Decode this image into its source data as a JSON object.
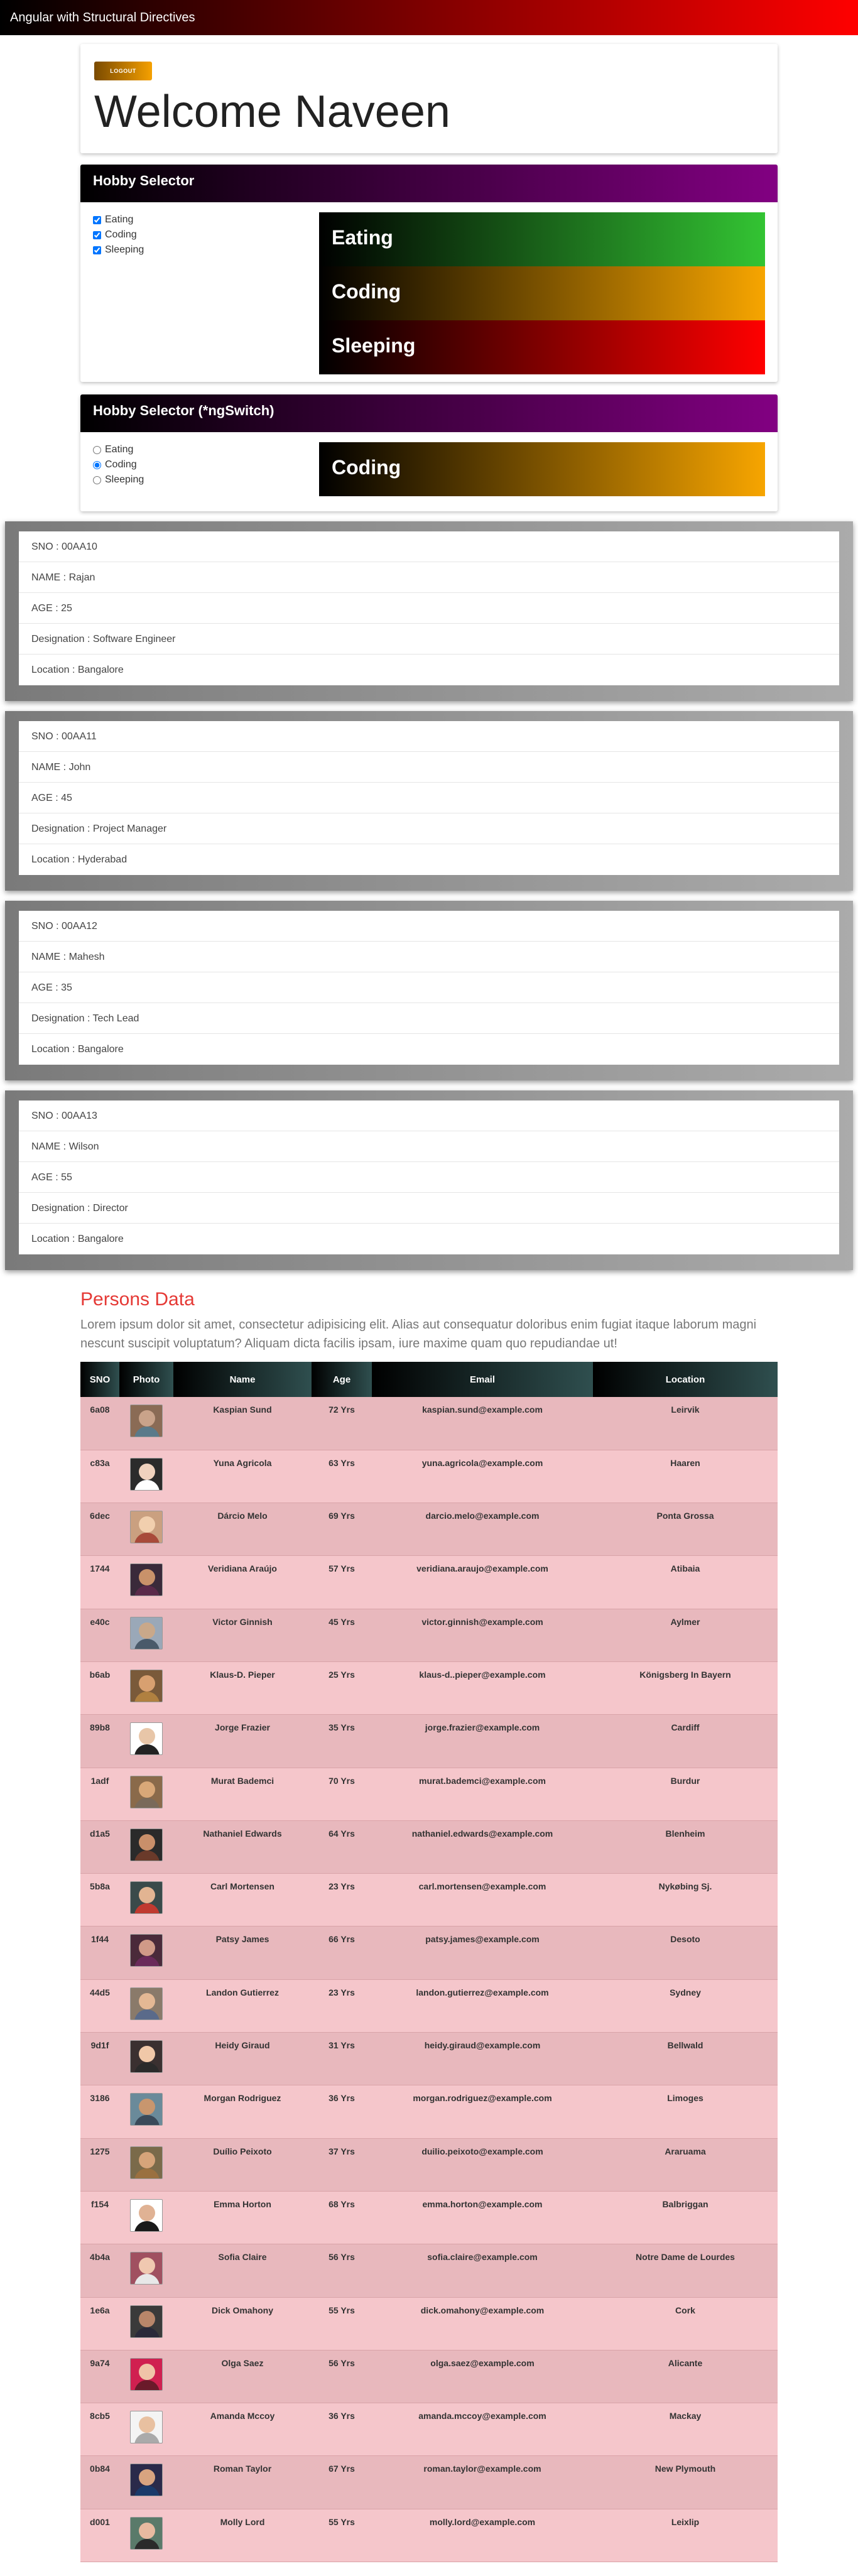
{
  "app": {
    "title": "Angular with Structural Directives"
  },
  "welcome": {
    "logout_label": "LOGOUT",
    "heading": "Welcome Naveen"
  },
  "hobby_selector": {
    "title": "Hobby Selector",
    "options": [
      {
        "label": "Eating",
        "checked": true
      },
      {
        "label": "Coding",
        "checked": true
      },
      {
        "label": "Sleeping",
        "checked": true
      }
    ],
    "panels": [
      "Eating",
      "Coding",
      "Sleeping"
    ]
  },
  "hobby_switch": {
    "title": "Hobby Selector (*ngSwitch)",
    "options": [
      {
        "label": "Eating",
        "selected": false
      },
      {
        "label": "Coding",
        "selected": true
      },
      {
        "label": "Sleeping",
        "selected": false
      }
    ],
    "panel": "Coding"
  },
  "employees": [
    {
      "sno": "SNO : 00AA10",
      "name": "NAME : Rajan",
      "age": "AGE : 25",
      "designation": "Designation : Software Engineer",
      "location": "Location : Bangalore"
    },
    {
      "sno": "SNO : 00AA11",
      "name": "NAME : John",
      "age": "AGE : 45",
      "designation": "Designation : Project Manager",
      "location": "Location : Hyderabad"
    },
    {
      "sno": "SNO : 00AA12",
      "name": "NAME : Mahesh",
      "age": "AGE : 35",
      "designation": "Designation : Tech Lead",
      "location": "Location : Bangalore"
    },
    {
      "sno": "SNO : 00AA13",
      "name": "NAME : Wilson",
      "age": "AGE : 55",
      "designation": "Designation : Director",
      "location": "Location : Bangalore"
    }
  ],
  "persons": {
    "title": "Persons Data",
    "description": "Lorem ipsum dolor sit amet, consectetur adipisicing elit. Alias aut consequatur doloribus enim fugiat itaque laborum magni nescunt suscipit voluptatum? Aliquam dicta facilis ipsam, iure maxime quam quo repudiandae ut!",
    "columns": [
      "SNO",
      "Photo",
      "Name",
      "Age",
      "Email",
      "Location"
    ],
    "rows": [
      {
        "sno": "6a08",
        "name": "Kaspian Sund",
        "age": "72 Yrs",
        "email": "kaspian.sund@example.com",
        "location": "Leirvik",
        "photo": "avatar-icon"
      },
      {
        "sno": "c83a",
        "name": "Yuna Agricola",
        "age": "63 Yrs",
        "email": "yuna.agricola@example.com",
        "location": "Haaren",
        "photo": "avatar-icon"
      },
      {
        "sno": "6dec",
        "name": "Dárcio Melo",
        "age": "69 Yrs",
        "email": "darcio.melo@example.com",
        "location": "Ponta Grossa",
        "photo": "avatar-icon"
      },
      {
        "sno": "1744",
        "name": "Veridiana Araújo",
        "age": "57 Yrs",
        "email": "veridiana.araujo@example.com",
        "location": "Atibaia",
        "photo": "avatar-icon"
      },
      {
        "sno": "e40c",
        "name": "Victor Ginnish",
        "age": "45 Yrs",
        "email": "victor.ginnish@example.com",
        "location": "Aylmer",
        "photo": "avatar-icon"
      },
      {
        "sno": "b6ab",
        "name": "Klaus-D. Pieper",
        "age": "25 Yrs",
        "email": "klaus-d..pieper@example.com",
        "location": "Königsberg In Bayern",
        "photo": "avatar-icon"
      },
      {
        "sno": "89b8",
        "name": "Jorge Frazier",
        "age": "35 Yrs",
        "email": "jorge.frazier@example.com",
        "location": "Cardiff",
        "photo": "avatar-icon"
      },
      {
        "sno": "1adf",
        "name": "Murat Bademci",
        "age": "70 Yrs",
        "email": "murat.bademci@example.com",
        "location": "Burdur",
        "photo": "avatar-icon"
      },
      {
        "sno": "d1a5",
        "name": "Nathaniel Edwards",
        "age": "64 Yrs",
        "email": "nathaniel.edwards@example.com",
        "location": "Blenheim",
        "photo": "avatar-icon"
      },
      {
        "sno": "5b8a",
        "name": "Carl Mortensen",
        "age": "23 Yrs",
        "email": "carl.mortensen@example.com",
        "location": "Nykøbing Sj.",
        "photo": "avatar-icon"
      },
      {
        "sno": "1f44",
        "name": "Patsy James",
        "age": "66 Yrs",
        "email": "patsy.james@example.com",
        "location": "Desoto",
        "photo": "avatar-icon"
      },
      {
        "sno": "44d5",
        "name": "Landon Gutierrez",
        "age": "23 Yrs",
        "email": "landon.gutierrez@example.com",
        "location": "Sydney",
        "photo": "avatar-icon"
      },
      {
        "sno": "9d1f",
        "name": "Heidy Giraud",
        "age": "31 Yrs",
        "email": "heidy.giraud@example.com",
        "location": "Bellwald",
        "photo": "avatar-icon"
      },
      {
        "sno": "3186",
        "name": "Morgan Rodriguez",
        "age": "36 Yrs",
        "email": "morgan.rodriguez@example.com",
        "location": "Limoges",
        "photo": "avatar-icon"
      },
      {
        "sno": "1275",
        "name": "Duílio Peixoto",
        "age": "37 Yrs",
        "email": "duilio.peixoto@example.com",
        "location": "Araruama",
        "photo": "avatar-icon"
      },
      {
        "sno": "f154",
        "name": "Emma Horton",
        "age": "68 Yrs",
        "email": "emma.horton@example.com",
        "location": "Balbriggan",
        "photo": "avatar-icon"
      },
      {
        "sno": "4b4a",
        "name": "Sofia Claire",
        "age": "56 Yrs",
        "email": "sofia.claire@example.com",
        "location": "Notre Dame de Lourdes",
        "photo": "avatar-icon"
      },
      {
        "sno": "1e6a",
        "name": "Dick Omahony",
        "age": "55 Yrs",
        "email": "dick.omahony@example.com",
        "location": "Cork",
        "photo": "avatar-icon"
      },
      {
        "sno": "9a74",
        "name": "Olga Saez",
        "age": "56 Yrs",
        "email": "olga.saez@example.com",
        "location": "Alicante",
        "photo": "avatar-icon"
      },
      {
        "sno": "8cb5",
        "name": "Amanda Mccoy",
        "age": "36 Yrs",
        "email": "amanda.mccoy@example.com",
        "location": "Mackay",
        "photo": "avatar-icon"
      },
      {
        "sno": "0b84",
        "name": "Roman Taylor",
        "age": "67 Yrs",
        "email": "roman.taylor@example.com",
        "location": "New Plymouth",
        "photo": "avatar-icon"
      },
      {
        "sno": "d001",
        "name": "Molly Lord",
        "age": "55 Yrs",
        "email": "molly.lord@example.com",
        "location": "Leixlip",
        "photo": "avatar-icon"
      }
    ]
  },
  "colors": {
    "topbar_gradient": [
      "#000000",
      "#ff0000"
    ],
    "hobby_header_gradient": [
      "#000000",
      "#820082"
    ],
    "eating": "#33c433",
    "coding": "#f7a500",
    "sleeping": "#ff0000",
    "persons_title": "#e53935",
    "row_odd": "#e8b8bd",
    "row_even": "#f5c6cb"
  }
}
